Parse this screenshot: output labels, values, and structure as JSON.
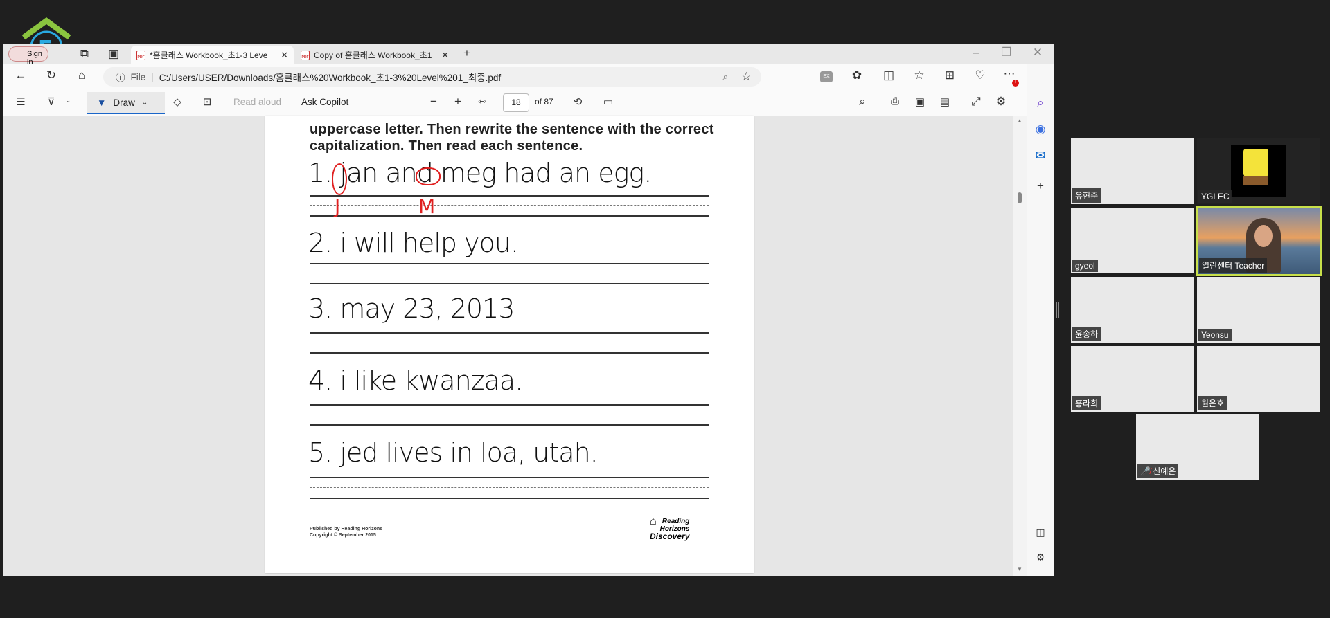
{
  "browser": {
    "profile_label": "Sign in",
    "tabs": [
      {
        "title": "*홈클래스 Workbook_초1-3 Leve",
        "active": true
      },
      {
        "title": "Copy of 홈클래스 Workbook_초1",
        "active": false
      }
    ],
    "address_scheme": "File",
    "url": "C:/Users/USER/Downloads/홈클래스%20Workbook_초1-3%20Level%201_최종.pdf",
    "extension_label": "EX",
    "notification_badge": "!"
  },
  "pdf_toolbar": {
    "draw_label": "Draw",
    "read_aloud_label": "Read aloud",
    "ask_copilot_label": "Ask Copilot",
    "page_number": "18",
    "page_total": "of 87"
  },
  "document": {
    "instructions": [
      "uppercase letter. Then rewrite the sentence with the correct",
      "capitalization. Then read each sentence."
    ],
    "sentences": [
      "1.  jan and meg had an egg.",
      "2. i will help you.",
      "3.  may 23, 2013",
      "4.  i like kwanzaa.",
      "5. jed lives in loa, utah."
    ],
    "annotations": [
      "J",
      "M"
    ],
    "footer": [
      "Published by Reading Horizons",
      "Copyright © September 2015"
    ],
    "publisher_logo": [
      "Reading",
      "Horizons",
      "Discovery"
    ]
  },
  "video_call": {
    "participants": [
      {
        "name": "유현준"
      },
      {
        "name": "YGLEC"
      },
      {
        "name": "gyeol"
      },
      {
        "name": "열린센터 Teacher",
        "active_speaker": true
      },
      {
        "name": "윤송하"
      },
      {
        "name": "Yeonsu"
      },
      {
        "name": "홍라희"
      },
      {
        "name": "원은호"
      },
      {
        "name": "신예은",
        "muted": true
      }
    ],
    "active_speaker_color": "#c8e04a"
  },
  "colors": {
    "annotation": "#e02020",
    "accent": "#1a66c9"
  }
}
